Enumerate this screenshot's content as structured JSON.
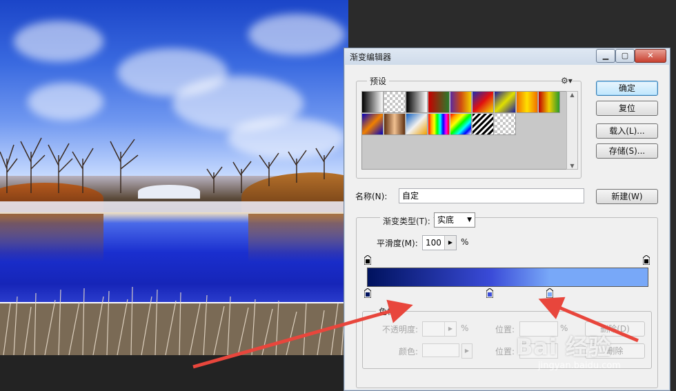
{
  "dialog": {
    "title": "渐变编辑器",
    "presets_label": "预设",
    "gear_icon": "gear-icon",
    "buttons": {
      "ok": "确定",
      "reset": "复位",
      "load": "载入(L)...",
      "save": "存储(S)...",
      "new": "新建(W)"
    },
    "name_label": "名称(N):",
    "name_value": "自定",
    "gradient_type_label": "渐变类型(T):",
    "gradient_type_value": "实底",
    "smoothness_label": "平滑度(M):",
    "smoothness_value": "100",
    "percent": "%",
    "stops_label": "色标",
    "opacity_label": "不透明度:",
    "opacity_percent": "%",
    "position_label": "位置:",
    "position_percent": "%",
    "delete_label": "删除(D)",
    "color_label": "颜色:",
    "position2_label": "位置:",
    "delete2_label": "删除"
  },
  "presets": [
    "linear-gradient(90deg,#000,#fff)",
    "checker",
    "linear-gradient(90deg,#000,#fff)",
    "linear-gradient(90deg,#c80000,#2a7a2a)",
    "linear-gradient(90deg,#5a2aa0,#d04a10,#f0d000)",
    "linear-gradient(135deg,#1b2bb0,#e01010,#f0e000)",
    "linear-gradient(135deg,#1a1aa0,#e0e000,#1a1aa0)",
    "linear-gradient(90deg,#f07000,#ffe000,#f07000)",
    "linear-gradient(90deg,#c00000,#f0d000,#2a9a2a)",
    "linear-gradient(135deg,#0000c0,#f08000,#0000c0)",
    "linear-gradient(90deg,#603010,#f0c090,#603010)",
    "linear-gradient(135deg,#1060c0,#f0f0f0,#f0a000)",
    "linear-gradient(90deg,red,orange,yellow,lime,cyan,blue,magenta,red)",
    "linear-gradient(135deg,red,orange,yellow,lime,cyan,blue,#fff)",
    "repeating-linear-gradient(135deg,#000 0 3px,#fff 3px 6px)",
    "checker"
  ],
  "gradient": {
    "start_color": "#00125e",
    "mid_color": "#3a4bd8",
    "end_color": "#78a8f8"
  },
  "watermark": {
    "brand": "Bai 经验",
    "url": "jingyan.baidu.com"
  }
}
